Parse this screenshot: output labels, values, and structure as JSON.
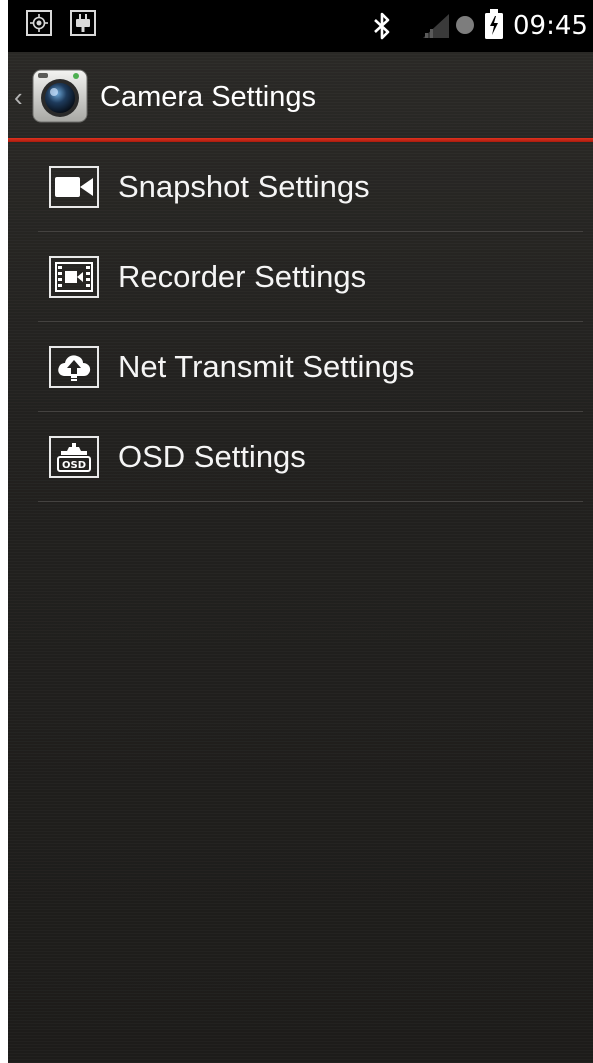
{
  "status_bar": {
    "time": "09:45",
    "icons": [
      "gps-icon",
      "usb-icon",
      "bluetooth-icon",
      "signal-icon",
      "record-dot-icon",
      "battery-icon"
    ]
  },
  "action_bar": {
    "back_glyph": "‹",
    "title": "Camera Settings",
    "app_icon": "camera-app-icon"
  },
  "colors": {
    "accent": "#d62d1c",
    "background": "#232220",
    "status_bar": "#000000",
    "text": "#ffffff"
  },
  "settings": {
    "items": [
      {
        "label": "Snapshot Settings",
        "icon": "video-camera-icon"
      },
      {
        "label": "Recorder Settings",
        "icon": "film-recorder-icon"
      },
      {
        "label": "Net Transmit Settings",
        "icon": "cloud-upload-icon"
      },
      {
        "label": "OSD Settings",
        "icon": "osd-icon",
        "icon_text": "OSD"
      }
    ]
  }
}
